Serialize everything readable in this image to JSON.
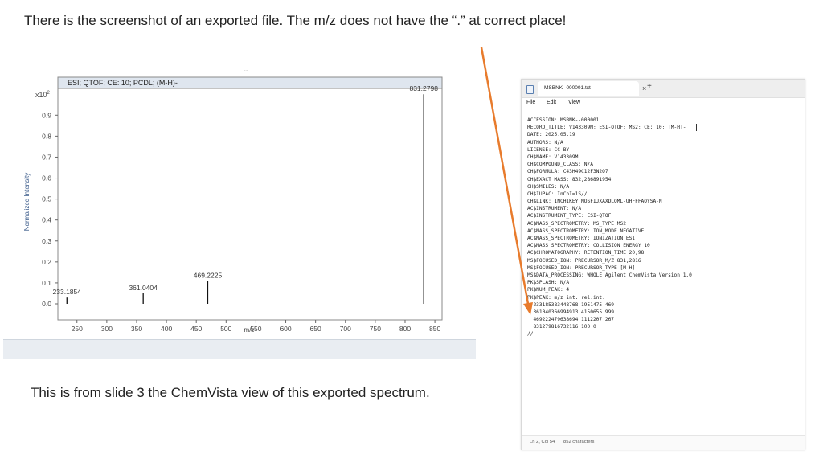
{
  "slide": {
    "title": "There is the screenshot of an exported file. The m/z does not have the “.” at correct place!",
    "caption": "This is from slide 3 the ChemVista view of this exported spectrum."
  },
  "spectrum": {
    "header": "ESI; QTOF; CE: 10; PCDL; (M-H)-",
    "y_scale_label": "x10",
    "y_scale_exp": "2",
    "ylabel": "Normalized Intensity",
    "xlabel": "m/z",
    "colors": {
      "frame": "#7a7a7a",
      "header_bg": "#dfe6ef",
      "peak": "#111111",
      "ylabel": "#3b5b8a"
    }
  },
  "chart_data": {
    "type": "bar",
    "title": "ESI; QTOF; CE: 10; PCDL; (M-H)-",
    "xlabel": "m/z",
    "ylabel": "Normalized Intensity",
    "xlim": [
      218,
      862
    ],
    "ylim": [
      0,
      1.02
    ],
    "x_ticks": [
      250,
      300,
      350,
      400,
      450,
      500,
      550,
      600,
      650,
      700,
      750,
      800,
      850
    ],
    "y_ticks": [
      0.0,
      0.1,
      0.2,
      0.3,
      0.4,
      0.5,
      0.6,
      0.7,
      0.8,
      0.9
    ],
    "series": [
      {
        "x": [
          233.1854,
          361.0404,
          469.2225,
          831.2798
        ],
        "y": [
          0.03,
          0.05,
          0.11,
          1.0
        ],
        "labels": [
          "233.1854",
          "361.0404",
          "469.2225",
          "831.2798"
        ]
      }
    ]
  },
  "notepad": {
    "tab_title": "MSBNK--000001.txt",
    "close_glyph": "×",
    "plus_glyph": "+",
    "menu": [
      "File",
      "Edit",
      "View"
    ],
    "lines": [
      "ACCESSION: MSBNK--000001",
      "RECORD_TITLE: V143309M; ESI-QTOF; MS2; CE: 10; [M-H]-",
      "DATE: 2025.05.19",
      "AUTHORS: N/A",
      "LICENSE: CC BY",
      "CH$NAME: V143309M",
      "CH$COMPOUND_CLASS: N/A",
      "CH$FORMULA: C43H49C12F3N2O7",
      "CH$EXACT_MASS: 832,286891954",
      "CH$SMILES: N/A",
      "CH$IUPAC: InChI=1S//",
      "CH$LINK: INCHIKEY MOSFIJXAXDLOML-UHFFFAOYSA-N",
      "AC$INSTRUMENT: N/A",
      "AC$INSTRUMENT_TYPE: ESI-QTOF",
      "AC$MASS_SPECTROMETRY: MS_TYPE MS2",
      "AC$MASS_SPECTROMETRY: ION_MODE NEGATIVE",
      "AC$MASS_SPECTROMETRY: IONIZATION ESI",
      "AC$MASS_SPECTROMETRY: COLLISION_ENERGY 10",
      "AC$CHROMATOGRAPHY: RETENTION_TIME 20,98",
      "MS$FOCUSED_ION: PRECURSOR_M/Z 831,2816",
      "MS$FOCUSED_ION: PRECURSOR_TYPE [M-H]-",
      "MS$DATA_PROCESSING: WHOLE Agilent ChemVista Version 1.0",
      "PK$SPLASH: N/A",
      "PK$NUM_PEAK: 4",
      "PK$PEAK: m/z int. rel.int.",
      "  233185383448768 1951475 469",
      "  361040366994913 4150655 999",
      "  469222479638694 1112207 267",
      "  831279816732116 100 0",
      "//"
    ],
    "status_position": "Ln 2, Col 54",
    "status_chars": "852 characters"
  },
  "arrow": {
    "color": "#e87b2c"
  }
}
